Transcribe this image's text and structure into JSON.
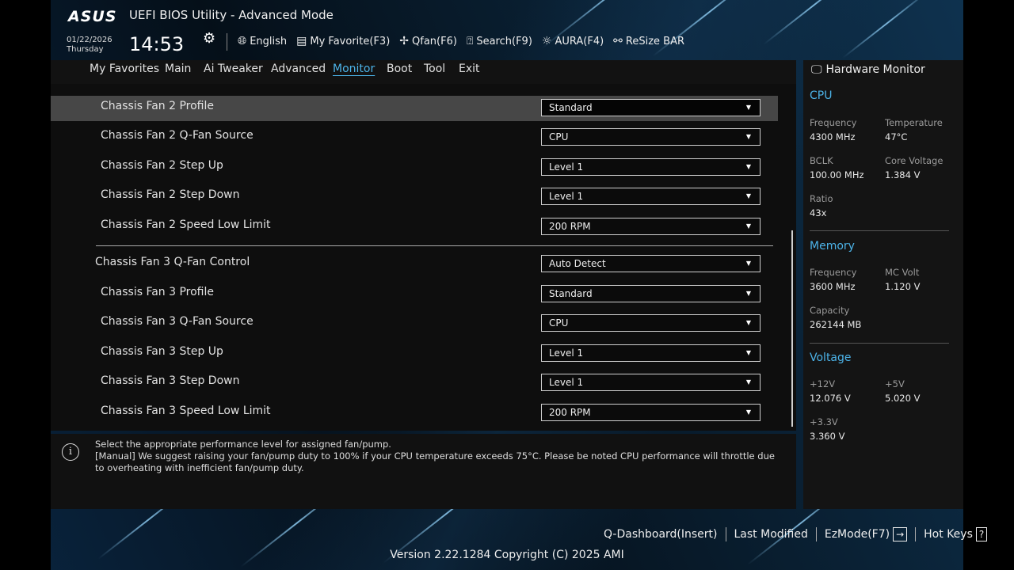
{
  "header": {
    "logo_text": "ASUS",
    "title": "UEFI BIOS Utility - Advanced Mode",
    "date": "01/22/2026",
    "weekday": "Thursday",
    "time": "14:53",
    "toolbar": [
      {
        "icon": "globe-icon",
        "label": "English"
      },
      {
        "icon": "favorite-icon",
        "label": "My Favorite(F3)"
      },
      {
        "icon": "fan-icon",
        "label": "Qfan(F6)"
      },
      {
        "icon": "search-icon",
        "label": "Search(F9)"
      },
      {
        "icon": "aura-icon",
        "label": "AURA(F4)"
      },
      {
        "icon": "resize-bar-icon",
        "label": "ReSize BAR"
      }
    ]
  },
  "nav": {
    "tabs": [
      "My Favorites",
      "Main",
      "Ai Tweaker",
      "Advanced",
      "Monitor",
      "Boot",
      "Tool",
      "Exit"
    ],
    "active": "Monitor"
  },
  "settings": [
    {
      "label": "Chassis Fan 2 Profile",
      "value": "Standard",
      "selected": true
    },
    {
      "label": "Chassis Fan 2 Q-Fan Source",
      "value": "CPU"
    },
    {
      "label": "Chassis Fan 2 Step Up",
      "value": "Level 1"
    },
    {
      "label": "Chassis Fan 2 Step Down",
      "value": "Level 1"
    },
    {
      "label": "Chassis Fan 2 Speed Low Limit",
      "value": "200 RPM"
    },
    {
      "label": "Chassis Fan 3 Q-Fan Control",
      "value": "Auto Detect"
    },
    {
      "label": "Chassis Fan 3 Profile",
      "value": "Standard"
    },
    {
      "label": "Chassis Fan 3 Q-Fan Source",
      "value": "CPU"
    },
    {
      "label": "Chassis Fan 3 Step Up",
      "value": "Level 1"
    },
    {
      "label": "Chassis Fan 3 Step Down",
      "value": "Level 1"
    },
    {
      "label": "Chassis Fan 3 Speed Low Limit",
      "value": "200 RPM"
    }
  ],
  "help": {
    "line1": "Select the appropriate performance level for assigned fan/pump.",
    "line2": "[Manual] We suggest raising your fan/pump duty to 100% if your CPU temperature exceeds 75°C. Please be noted CPU performance will throttle due to overheating with inefficient fan/pump duty."
  },
  "hw_monitor": {
    "title": "Hardware Monitor",
    "cpu": {
      "heading": "CPU",
      "frequency_label": "Frequency",
      "frequency": "4300 MHz",
      "temperature_label": "Temperature",
      "temperature": "47°C",
      "bclk_label": "BCLK",
      "bclk": "100.00 MHz",
      "core_voltage_label": "Core Voltage",
      "core_voltage": "1.384 V",
      "ratio_label": "Ratio",
      "ratio": "43x"
    },
    "memory": {
      "heading": "Memory",
      "frequency_label": "Frequency",
      "frequency": "3600 MHz",
      "mc_volt_label": "MC Volt",
      "mc_volt": "1.120 V",
      "capacity_label": "Capacity",
      "capacity": "262144 MB"
    },
    "voltage": {
      "heading": "Voltage",
      "v12_label": "+12V",
      "v12": "12.076 V",
      "v5_label": "+5V",
      "v5": "5.020 V",
      "v33_label": "+3.3V",
      "v33": "3.360 V"
    }
  },
  "footer": {
    "actions": [
      "Q-Dashboard(Insert)",
      "Last Modified",
      "EzMode(F7)",
      "Hot Keys"
    ],
    "version": "Version 2.22.1284 Copyright (C) 2025 AMI"
  },
  "colors": {
    "accent": "#4cb3e8",
    "panel": "#0e0e0e",
    "selected_row": "#474747"
  }
}
